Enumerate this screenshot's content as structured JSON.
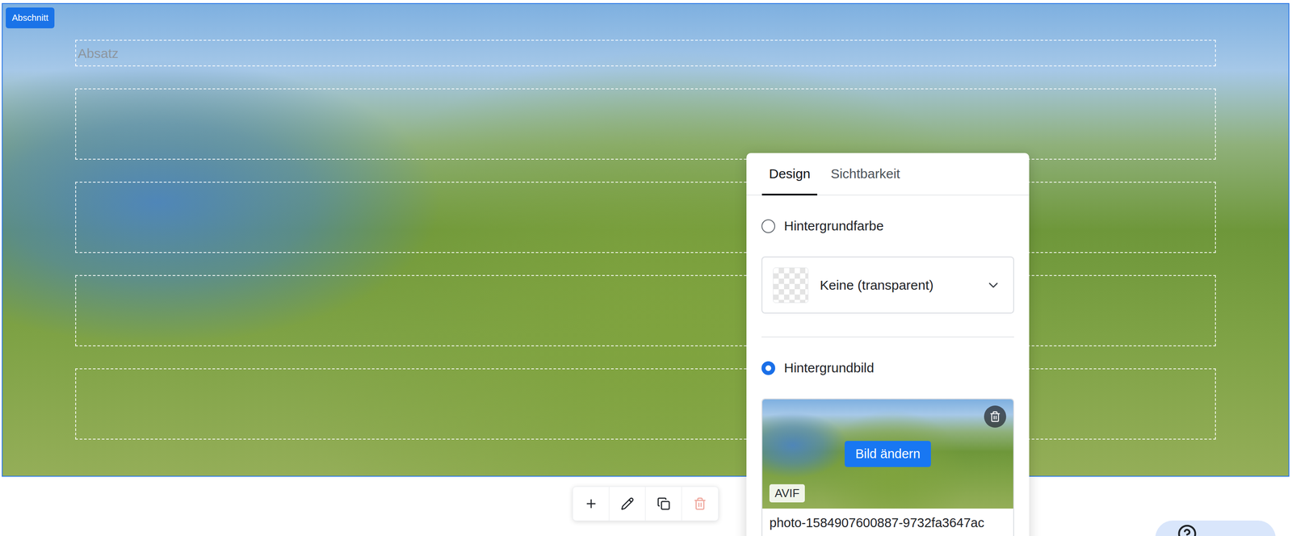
{
  "section": {
    "badge": "Abschnitt",
    "blocks": [
      {
        "kind": "paragraph",
        "placeholder": "Absatz"
      },
      {
        "kind": "empty",
        "placeholder": ""
      },
      {
        "kind": "empty",
        "placeholder": ""
      },
      {
        "kind": "empty",
        "placeholder": ""
      },
      {
        "kind": "empty",
        "placeholder": ""
      }
    ]
  },
  "panel": {
    "tabs": [
      {
        "label": "Design",
        "selected": true
      },
      {
        "label": "Sichtbarkeit",
        "selected": false
      }
    ],
    "background_options": [
      {
        "kind": "color",
        "label": "Hintergrundfarbe",
        "selected": false,
        "value": "Keine (transparent)"
      },
      {
        "kind": "image",
        "label": "Hintergrundbild",
        "selected": true,
        "button": "Bild ändern",
        "format": "AVIF",
        "filename": "photo-1584907600887-9732fa3647ac"
      }
    ]
  },
  "toolbar": [
    {
      "kind": "add",
      "disabled": false
    },
    {
      "kind": "edit",
      "disabled": false
    },
    {
      "kind": "copy",
      "disabled": false
    },
    {
      "kind": "delete",
      "disabled": true
    }
  ]
}
